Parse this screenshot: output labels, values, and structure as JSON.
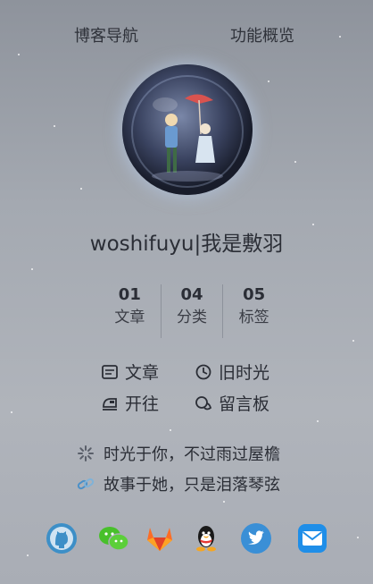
{
  "nav": {
    "blog_nav": "博客导航",
    "features": "功能概览"
  },
  "profile": {
    "name": "woshifuyu|我是敷羽"
  },
  "stats": [
    {
      "num": "01",
      "label": "文章"
    },
    {
      "num": "04",
      "label": "分类"
    },
    {
      "num": "05",
      "label": "标签"
    }
  ],
  "links": {
    "articles": "文章",
    "old_times": "旧时光",
    "travel": "开往",
    "guestbook": "留言板"
  },
  "quotes": {
    "q1": "时光于你，不过雨过屋檐",
    "q2": "故事于她，只是泪落琴弦"
  },
  "social": [
    "github-icon",
    "wechat-icon",
    "gitlab-icon",
    "qq-icon",
    "twitter-icon",
    "email-icon"
  ],
  "colors": {
    "github": "#3d8fc7",
    "wechat": "#48c02b",
    "gitlab": "#e24329",
    "twitter": "#3a8fd6",
    "email": "#1f8ee8"
  }
}
